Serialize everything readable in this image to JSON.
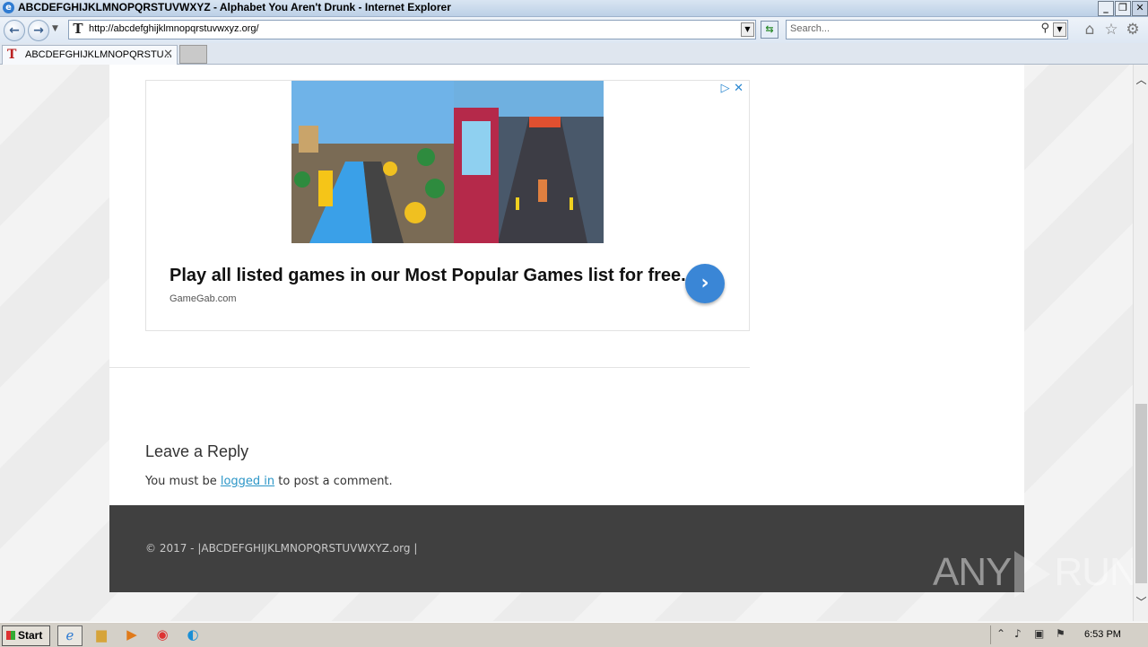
{
  "window": {
    "title": "ABCDEFGHIJKLMNOPQRSTUVWXYZ - Alphabet You Aren't Drunk - Internet Explorer",
    "controls": [
      "_",
      "❐",
      "✕"
    ]
  },
  "navbar": {
    "url": "http://abcdefghijklmnopqrstuvwxyz.org/",
    "search_placeholder": "Search..."
  },
  "tabs": [
    {
      "label": "ABCDEFGHIJKLMNOPQRSTU...",
      "favicon": "T"
    }
  ],
  "ad": {
    "headline": "Play all listed games in our Most Popular Games list for free.",
    "source": "GameGab.com",
    "icons": [
      "adchoices-icon",
      "close-icon",
      "chevron-right-icon"
    ]
  },
  "comments": {
    "heading": "Leave a Reply",
    "text_before": "You must be ",
    "link": "logged in",
    "text_after": " to post a comment."
  },
  "footer": {
    "copyright": "© 2017 - |ABCDEFGHIJKLMNOPQRSTUVWXYZ.org |"
  },
  "watermark": {
    "left": "ANY",
    "right": "RUN"
  },
  "taskbar": {
    "start_label": "Start",
    "apps": [
      "internet-explorer-icon",
      "folder-icon",
      "media-player-icon",
      "chrome-icon",
      "edge-icon"
    ],
    "clock": "6:53 PM"
  },
  "colors": {
    "link": "#2b96c7",
    "ad_button": "#3a86d6",
    "footer_bg": "#404040",
    "page_bg": "#ececec"
  }
}
